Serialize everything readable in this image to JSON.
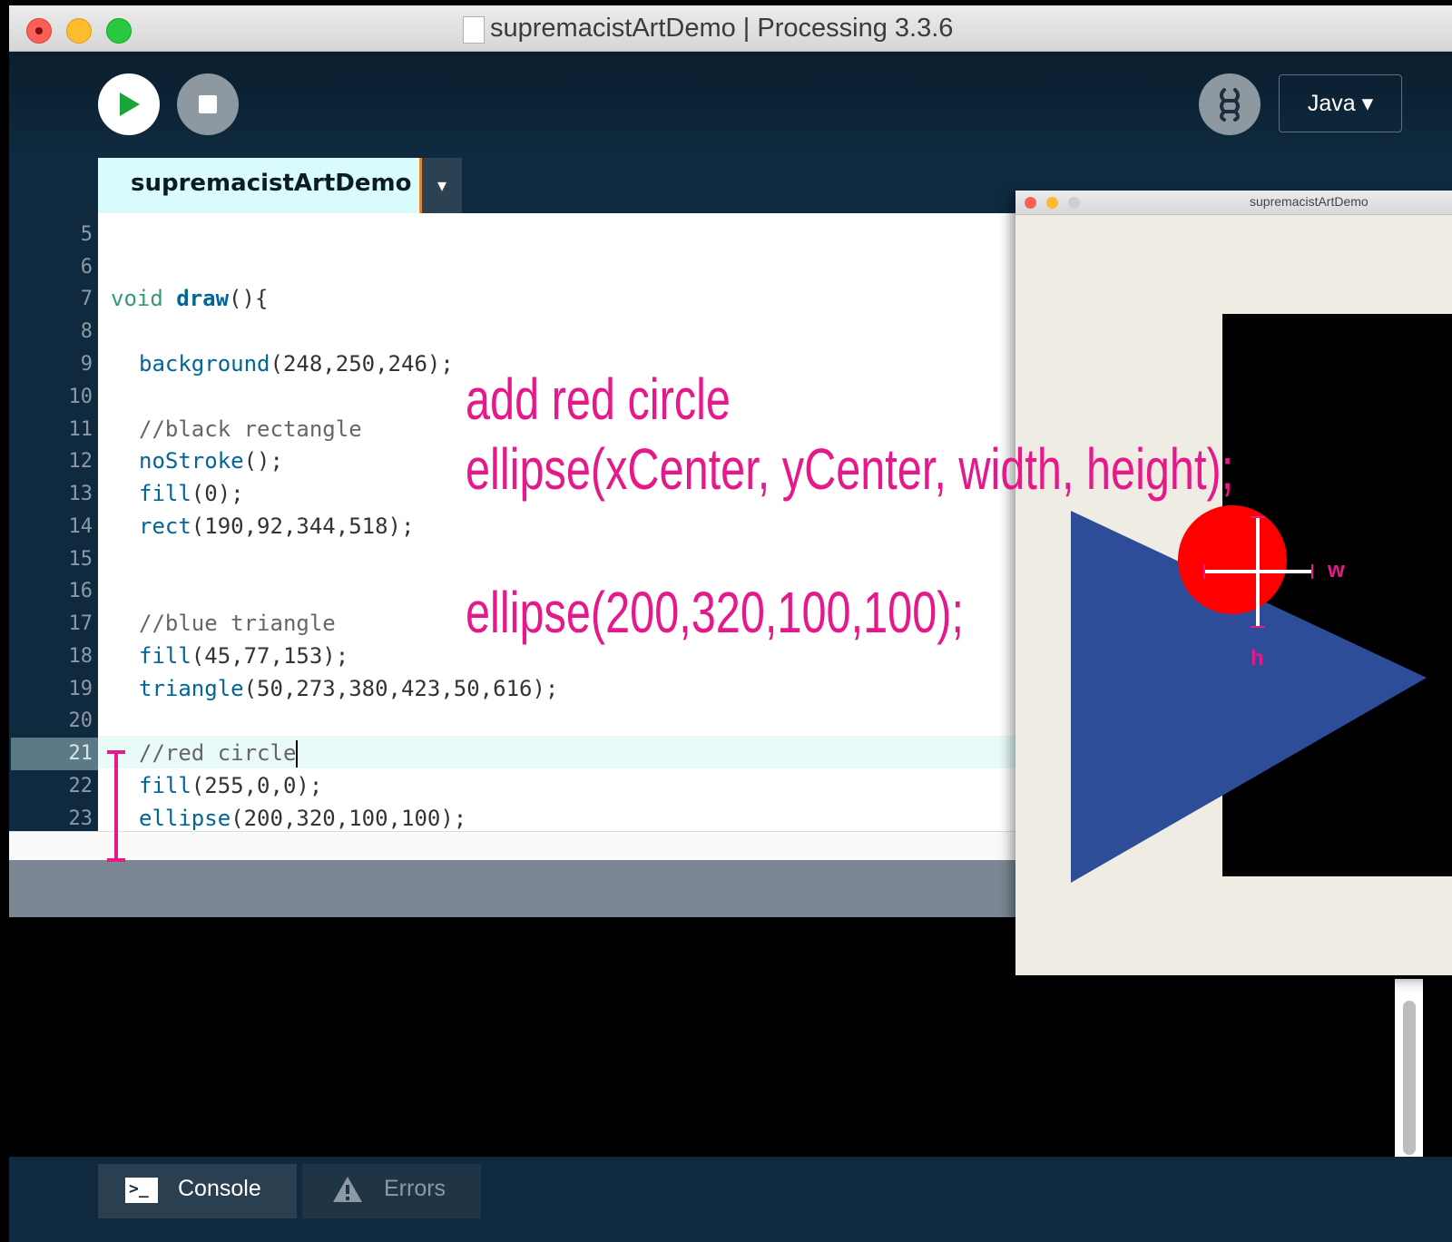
{
  "window": {
    "title": "supremacistArtDemo | Processing 3.3.6"
  },
  "toolbar": {
    "mode": "Java ▾"
  },
  "tab": {
    "name": "supremacistArtDemo",
    "menu_glyph": "▾"
  },
  "editor": {
    "current_line": 21,
    "line_numbers": [
      "5",
      "6",
      "7",
      "8",
      "9",
      "10",
      "11",
      "12",
      "13",
      "14",
      "15",
      "16",
      "17",
      "18",
      "19",
      "20",
      "21",
      "22",
      "23"
    ],
    "lines": {
      "l7_void": "void ",
      "l7_draw": "draw",
      "l7_rest": "(){",
      "l9_fn": "background",
      "l9_args": "(248,250,246);",
      "l11_comment": "//black rectangle",
      "l12_fn": "noStroke",
      "l12_args": "();",
      "l13_fn": "fill",
      "l13_args": "(0);",
      "l14_fn": "rect",
      "l14_args": "(190,92,344,518);",
      "l17_comment": "//blue triangle",
      "l18_fn": "fill",
      "l18_args": "(45,77,153);",
      "l19_fn": "triangle",
      "l19_args": "(50,273,380,423,50,616);",
      "l21_comment": "//red circle",
      "l22_fn": "fill",
      "l22_args": "(255,0,0);",
      "l23_fn": "ellipse",
      "l23_args": "(200,320,100,100);"
    }
  },
  "annotations": {
    "line1": "add red circle",
    "line2": "ellipse(xCenter, yCenter, width, height);",
    "line3": "ellipse(200,320,100,100);",
    "width_label": "w",
    "height_label": "h",
    "color": "#e5198a"
  },
  "sketch_window": {
    "title": "supremacistArtDemo",
    "background": "#efede3",
    "rect_color": "#000000",
    "triangle_color": "#2d4d99",
    "circle_color": "#ff0000"
  },
  "bottom_tabs": {
    "console": "Console",
    "errors": "Errors"
  },
  "icons": [
    "play-icon",
    "stop-icon",
    "debug-icon",
    "console-icon",
    "warning-icon",
    "document-icon"
  ]
}
